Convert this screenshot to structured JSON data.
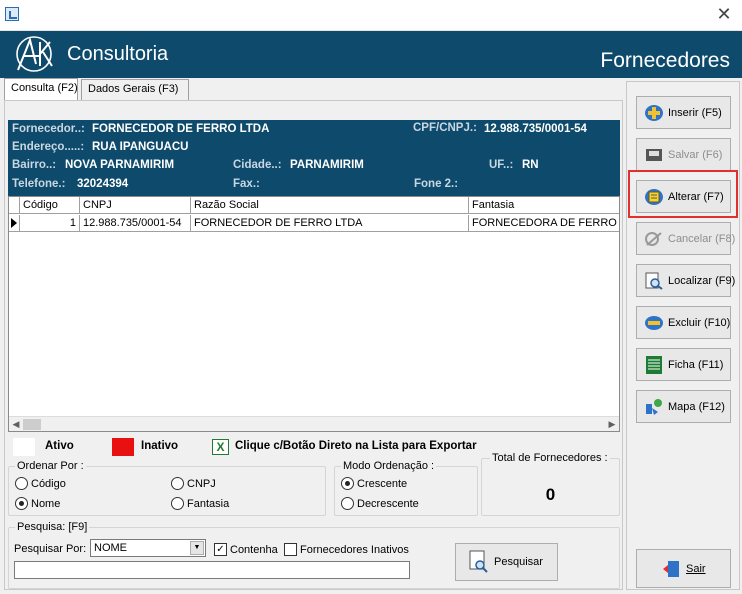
{
  "window": {
    "close_glyph": "✕"
  },
  "header": {
    "brand": "Consultoria",
    "module": "Fornecedores"
  },
  "tabs": [
    {
      "label": "Consulta (F2)",
      "active": true
    },
    {
      "label": "Dados Gerais (F3)",
      "active": false
    }
  ],
  "info": {
    "fornecedor_label": "Fornecedor..:",
    "fornecedor": "FORNECEDOR DE FERRO LTDA",
    "cpf_label": "CPF/CNPJ.:",
    "cpf": "12.988.735/0001-54",
    "endereco_label": "Endereço.....:",
    "endereco": "RUA IPANGUACU",
    "bairro_label": "Bairro..:",
    "bairro": "NOVA PARNAMIRIM",
    "cidade_label": "Cidade..:",
    "cidade": "PARNAMIRIM",
    "uf_label": "UF..:",
    "uf": "RN",
    "telefone_label": "Telefone.:",
    "telefone": "32024394",
    "fax_label": "Fax.:",
    "fax": "",
    "fone2_label": "Fone 2.:",
    "fone2": ""
  },
  "grid": {
    "columns": [
      "Código",
      "CNPJ",
      "Razão Social",
      "Fantasia"
    ],
    "rows": [
      {
        "codigo": "1",
        "cnpj": "12.988.735/0001-54",
        "razao": "FORNECEDOR DE FERRO LTDA",
        "fantasia": "FORNECEDORA DE FERRO L"
      }
    ]
  },
  "legend": {
    "ativo": "Ativo",
    "inativo": "Inativo",
    "export_icon": "X",
    "export": "Clique c/Botão Direto na Lista para Exportar",
    "ativo_color": "#ffffff",
    "inativo_color": "#e81010"
  },
  "ordenar": {
    "title": "Ordenar Por :",
    "codigo": "Código",
    "cnpj": "CNPJ",
    "nome": "Nome",
    "fantasia": "Fantasia",
    "selected": "Nome"
  },
  "modo": {
    "title": "Modo Ordenação :",
    "crescente": "Crescente",
    "decrescente": "Decrescente",
    "selected": "Crescente"
  },
  "total": {
    "title": "Total de Fornecedores :",
    "value": "0"
  },
  "pesquisa": {
    "title": "Pesquisa: [F9]",
    "por_label": "Pesquisar Por:",
    "por_value": "NOME",
    "contenha": "Contenha",
    "contenha_checked": "✓",
    "inativos": "Fornecedores Inativos",
    "button": "Pesquisar",
    "query": ""
  },
  "sidebar": {
    "inserir": "Inserir (F5)",
    "salvar": "Salvar (F6)",
    "alterar": "Alterar (F7)",
    "cancelar": "Cancelar (F8)",
    "localizar": "Localizar (F9)",
    "excluir": "Excluir (F10)",
    "ficha": "Ficha (F11)",
    "mapa": "Mapa (F12)",
    "sair": "Sair"
  }
}
